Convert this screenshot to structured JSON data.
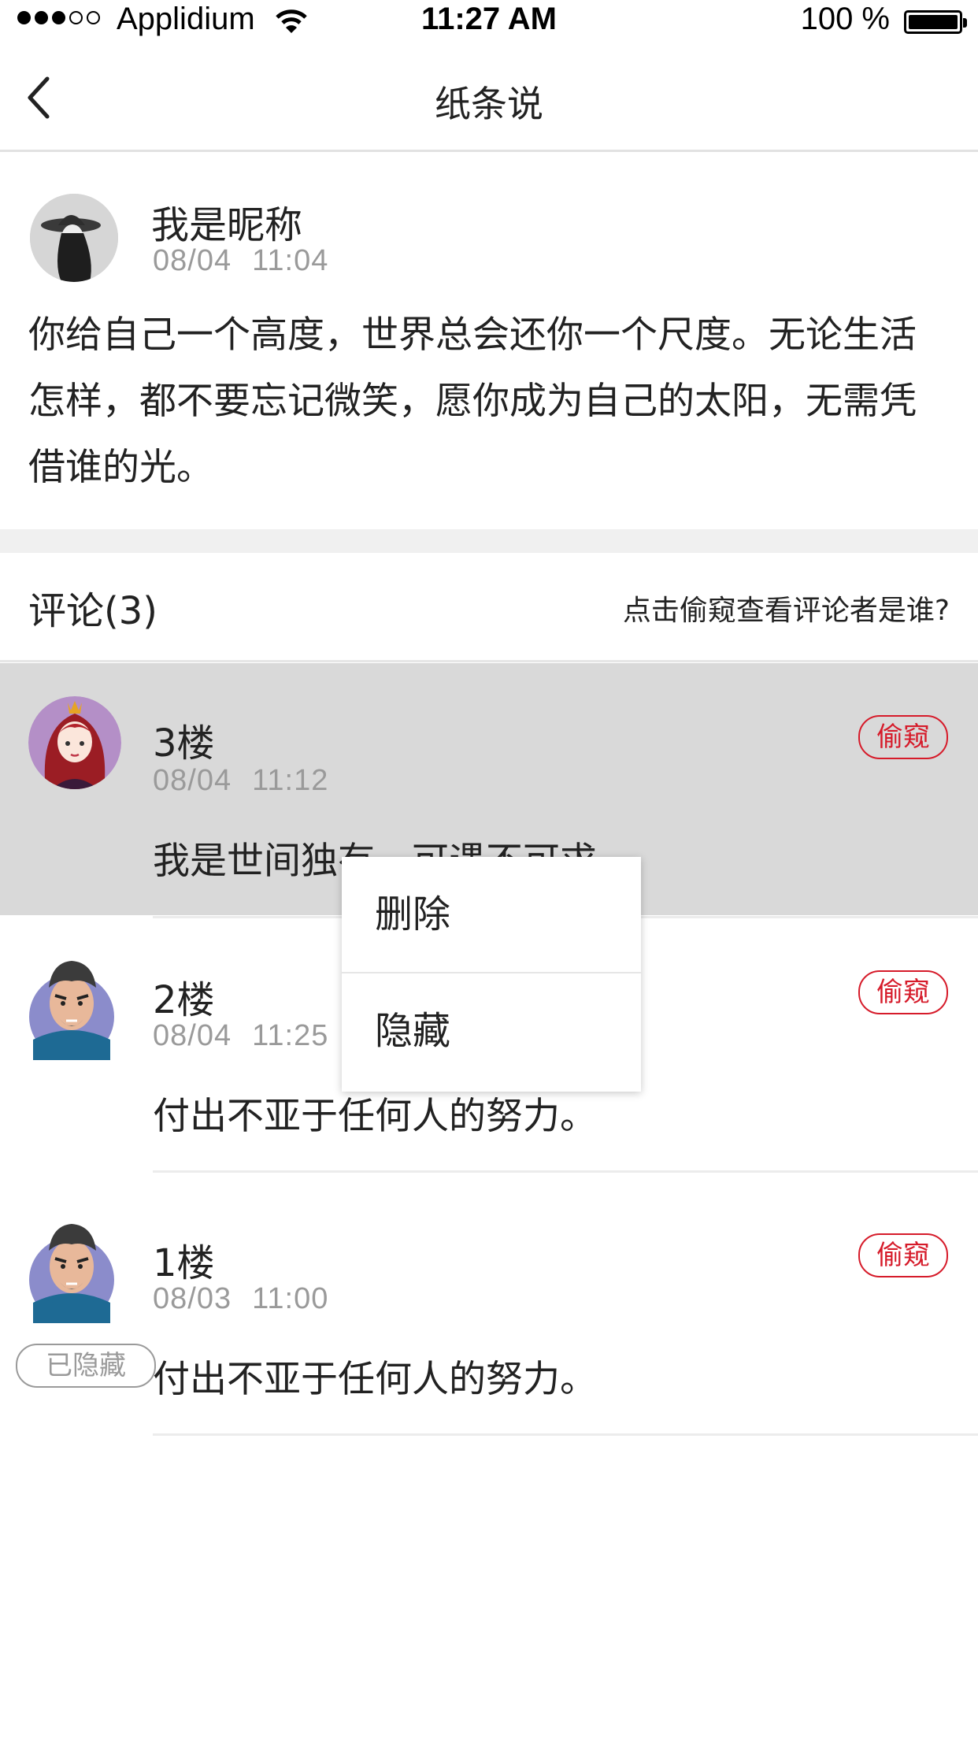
{
  "status_bar": {
    "carrier": "Applidium",
    "time": "11:27 AM",
    "battery": "100 %"
  },
  "nav": {
    "title": "纸条说"
  },
  "post": {
    "author": "我是昵称",
    "date": "08/04",
    "time": "11:04",
    "body": "你给自己一个高度，世界总会还你一个尺度。无论生活怎样，都不要忘记微笑，愿你成为自己的太阳，无需凭借谁的光。"
  },
  "comments_header": {
    "title": "评论(3)",
    "hint": "点击偷窥查看评论者是谁?"
  },
  "comments": [
    {
      "floor": "3楼",
      "date": "08/04",
      "time": "11:12",
      "text": "我是世间独有，可遇不可求。",
      "peek_label": "偷窥"
    },
    {
      "floor": "2楼",
      "date": "08/04",
      "time": "11:25",
      "text": "付出不亚于任何人的努力。",
      "peek_label": "偷窥"
    },
    {
      "floor": "1楼",
      "date": "08/03",
      "time": "11:00",
      "text": "付出不亚于任何人的努力。",
      "peek_label": "偷窥",
      "badge": "已隐藏"
    }
  ],
  "context_menu": {
    "items": [
      "删除",
      "隐藏"
    ]
  },
  "colors": {
    "accent": "#d61b2a",
    "highlight_row": "#d9d9d9",
    "muted_text": "#9a9a9a"
  }
}
